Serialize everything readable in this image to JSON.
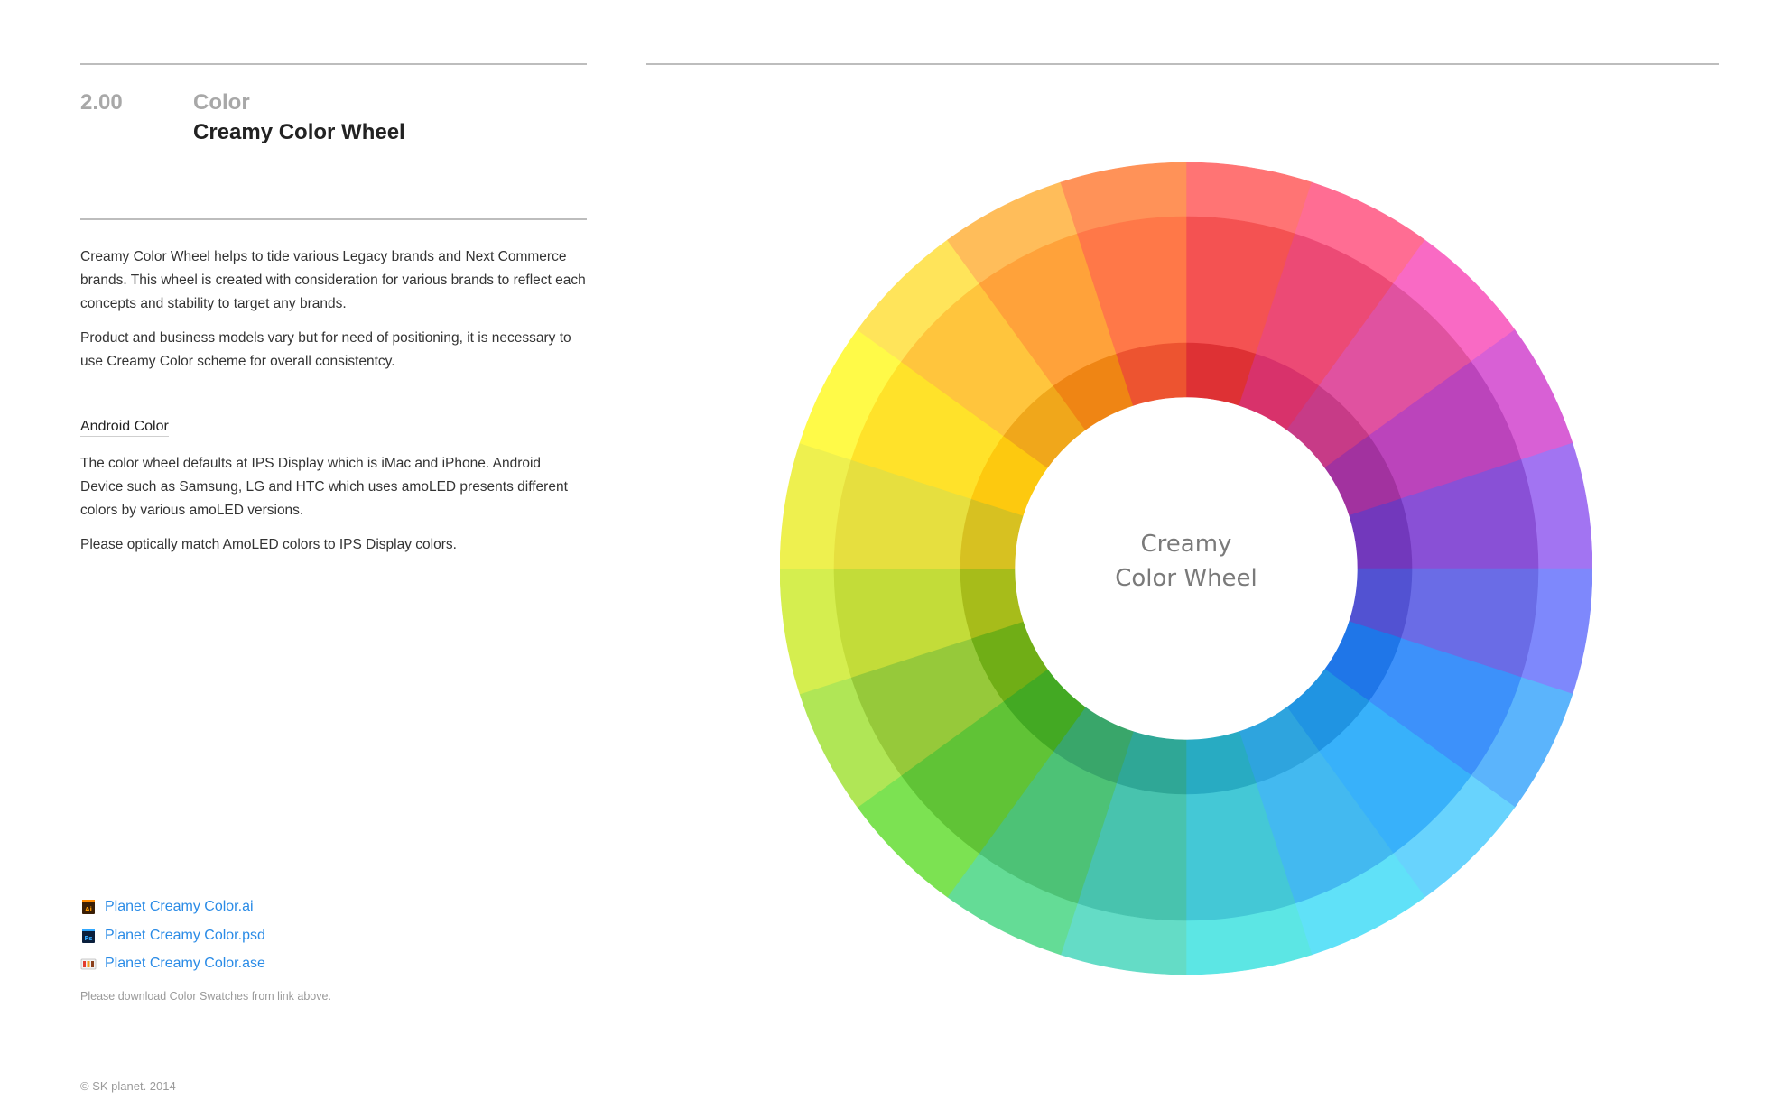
{
  "header": {
    "section_number": "2.00",
    "category": "Color",
    "title": "Creamy Color Wheel"
  },
  "intro": {
    "paragraphs": [
      "Creamy Color Wheel helps to tide various Legacy brands and Next Commerce brands. This wheel is created with consideration for various brands to reflect each concepts and stability to target any brands.",
      "Product and business models vary but for need of positioning, it is necessary to use Creamy Color scheme for overall consistentcy."
    ]
  },
  "android": {
    "heading": "Android Color",
    "paragraphs": [
      "The color wheel defaults at IPS Display which is iMac and iPhone. Android Device such as Samsung, LG and HTC which uses amoLED presents different colors by various amoLED versions.",
      "Please optically match AmoLED colors to IPS Display colors."
    ]
  },
  "downloads": {
    "files": [
      {
        "label": "Planet Creamy Color.ai",
        "icon": "illustrator-file-icon"
      },
      {
        "label": "Planet Creamy Color.psd",
        "icon": "photoshop-file-icon"
      },
      {
        "label": "Planet Creamy Color.ase",
        "icon": "swatch-file-icon"
      }
    ],
    "note": "Please download Color Swatches from link above."
  },
  "footer": {
    "copyright": "© SK planet. 2014"
  },
  "wheel": {
    "center_label_line1": "Creamy",
    "center_label_line2": "Color Wheel",
    "segments": [
      {
        "outer": "#ff7474",
        "middle": "#f45252",
        "inner": "#de3134"
      },
      {
        "outer": "#ff6d93",
        "middle": "#ec4a75",
        "inner": "#d8326b"
      },
      {
        "outer": "#f96ac4",
        "middle": "#e052a0",
        "inner": "#c73b87"
      },
      {
        "outer": "#d860d5",
        "middle": "#bb44bb",
        "inner": "#a2329f"
      },
      {
        "outer": "#a274f2",
        "middle": "#8950d6",
        "inner": "#7238bc"
      },
      {
        "outer": "#7e88fc",
        "middle": "#6a6ce6",
        "inner": "#5252d2"
      },
      {
        "outer": "#5bb4fc",
        "middle": "#3d91fa",
        "inner": "#1f76e8"
      },
      {
        "outer": "#68d3fd",
        "middle": "#38b1fa",
        "inner": "#2094e2"
      },
      {
        "outer": "#60e1f8",
        "middle": "#43b9f0",
        "inner": "#2ea4de"
      },
      {
        "outer": "#5ce6e4",
        "middle": "#44c8d6",
        "inner": "#28abc2"
      },
      {
        "outer": "#64dcc6",
        "middle": "#48c3ae",
        "inner": "#2fa796"
      },
      {
        "outer": "#64dc96",
        "middle": "#4dc276",
        "inner": "#39a66a"
      },
      {
        "outer": "#7ce252",
        "middle": "#60c336",
        "inner": "#43a923"
      },
      {
        "outer": "#b0e656",
        "middle": "#96c93a",
        "inner": "#70ae16"
      },
      {
        "outer": "#d5ee4f",
        "middle": "#c3dc39",
        "inner": "#a7bc1a"
      },
      {
        "outer": "#eef04f",
        "middle": "#e6df3f",
        "inner": "#d7c121"
      },
      {
        "outer": "#fffa48",
        "middle": "#ffe22a",
        "inner": "#fdc90f"
      },
      {
        "outer": "#ffe45a",
        "middle": "#ffc53d",
        "inner": "#f0a71b"
      },
      {
        "outer": "#ffbd5a",
        "middle": "#ffa23a",
        "inner": "#ef8514"
      },
      {
        "outer": "#ff9258",
        "middle": "#ff7848",
        "inner": "#ed5430"
      }
    ]
  }
}
